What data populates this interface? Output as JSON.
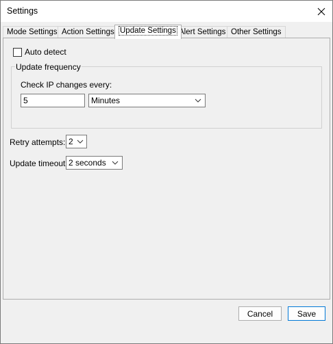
{
  "window": {
    "title": "Settings",
    "close_icon": "close-icon"
  },
  "tabs": [
    {
      "label": "Mode Settings",
      "active": false
    },
    {
      "label": "Action Settings",
      "active": false
    },
    {
      "label": "Update Settings",
      "active": true
    },
    {
      "label": "Alert Settings",
      "active": false
    },
    {
      "label": "Other Settings",
      "active": false
    }
  ],
  "update": {
    "auto_detect_label": "Auto detect",
    "auto_detect_checked": false,
    "frequency_group_title": "Update frequency",
    "check_ip_label": "Check IP changes every:",
    "interval_value": "5",
    "interval_unit": "Minutes",
    "retry_label": "Retry attempts:",
    "retry_value": "2",
    "timeout_label": "Update timeout:",
    "timeout_value": "2 seconds"
  },
  "footer": {
    "cancel_label": "Cancel",
    "save_label": "Save"
  },
  "colors": {
    "accent": "#0078d7",
    "window_bg": "#f0f0f0"
  }
}
